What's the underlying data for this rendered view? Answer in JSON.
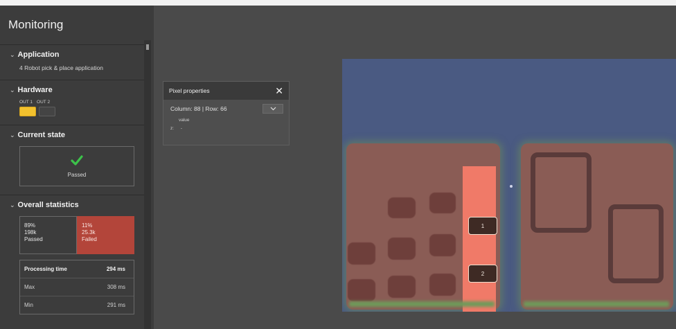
{
  "sidebar": {
    "title": "Monitoring",
    "application": {
      "heading": "Application",
      "description": "4 Robot pick & place application"
    },
    "hardware": {
      "heading": "Hardware",
      "outputs": [
        {
          "label": "OUT 1",
          "state": "on"
        },
        {
          "label": "OUT 2",
          "state": "off"
        }
      ]
    },
    "current_state": {
      "heading": "Current state",
      "status": "Passed"
    },
    "overall_statistics": {
      "heading": "Overall statistics",
      "passed": {
        "percent": "89%",
        "count": "198k",
        "label": "Passed"
      },
      "failed": {
        "percent": "11%",
        "count": "25.3k",
        "label": "Failed"
      },
      "processing": [
        {
          "label": "Processing time",
          "value": "294 ms"
        },
        {
          "label": "Max",
          "value": "308 ms"
        },
        {
          "label": "Min",
          "value": "291 ms"
        }
      ]
    }
  },
  "pixel_properties": {
    "title": "Pixel properties",
    "close": "✕",
    "position": "Column: 88 | Row: 66",
    "dropdown_icon": "chevron-down-icon",
    "value_header": "value",
    "z_label": "z:",
    "z_value": "-"
  },
  "image": {
    "tags": [
      "1",
      "2"
    ]
  },
  "colors": {
    "highlight": "#f07a68",
    "fail": "#b3453a",
    "hardware_on": "#f2c12e",
    "pass_check": "#3cc24a"
  }
}
